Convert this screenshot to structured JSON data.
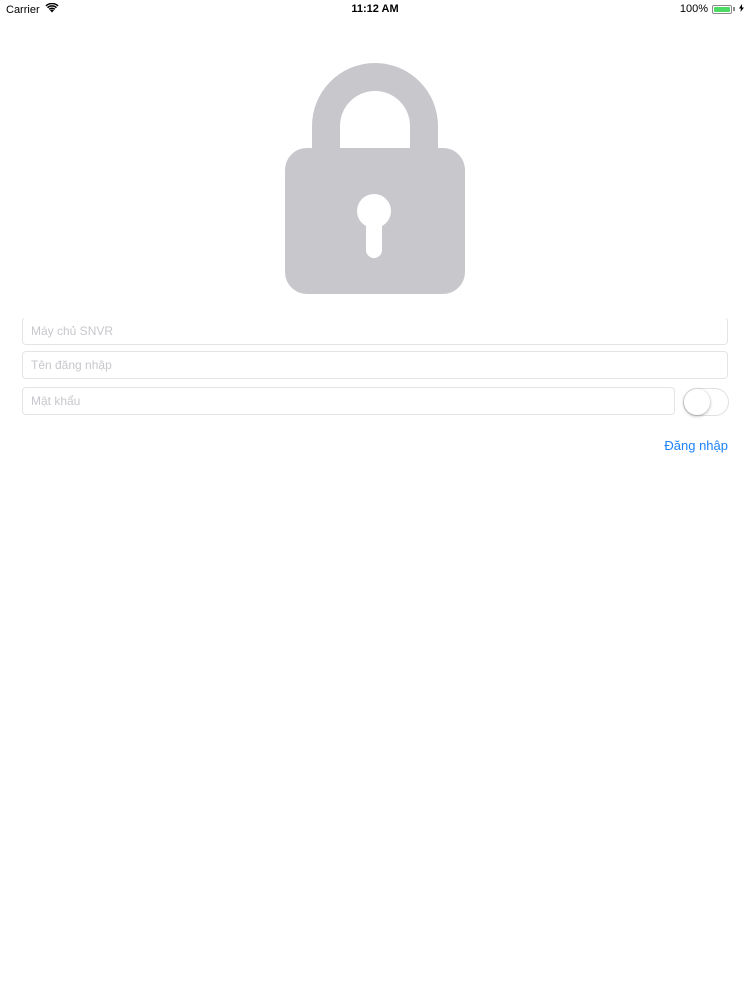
{
  "status_bar": {
    "carrier": "Carrier",
    "time": "11:12 AM",
    "battery_percent": "100%",
    "battery_level": 1.0,
    "battery_color": "#4cd964",
    "wifi_icon": "wifi-icon",
    "charging_icon": "charging-icon"
  },
  "hero": {
    "icon": "lock-icon",
    "color": "#c8c7cc"
  },
  "form": {
    "server_placeholder": "Máy chủ SNVR",
    "server_value": "",
    "username_placeholder": "Tên đăng nhập",
    "username_value": "",
    "password_placeholder": "Mật khẩu",
    "password_value": "",
    "show_password_toggle_on": false,
    "login_label": "Đăng nhập",
    "accent_color": "#1a82fb"
  }
}
